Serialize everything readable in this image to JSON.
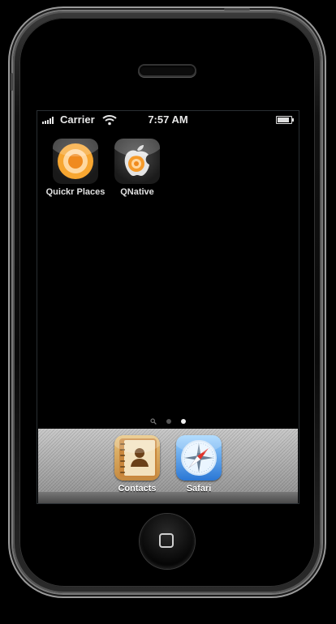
{
  "status_bar": {
    "carrier": "Carrier",
    "time": "7:57 AM",
    "battery_level": 1.0
  },
  "home_apps": [
    {
      "label": "Quickr Places",
      "icon": "quickr-places-icon"
    },
    {
      "label": "QNative",
      "icon": "qnative-icon"
    }
  ],
  "page_indicator": {
    "pages": 3,
    "active_page": 3,
    "first_is_search": true
  },
  "dock_apps": [
    {
      "label": "Contacts",
      "icon": "contacts-book-icon"
    },
    {
      "label": "Safari",
      "icon": "safari-compass-icon"
    }
  ],
  "colors": {
    "quickr_orange": "#f39a2a",
    "safari_blue": "#2a77d5",
    "contacts_tan": "#d8a55a"
  }
}
